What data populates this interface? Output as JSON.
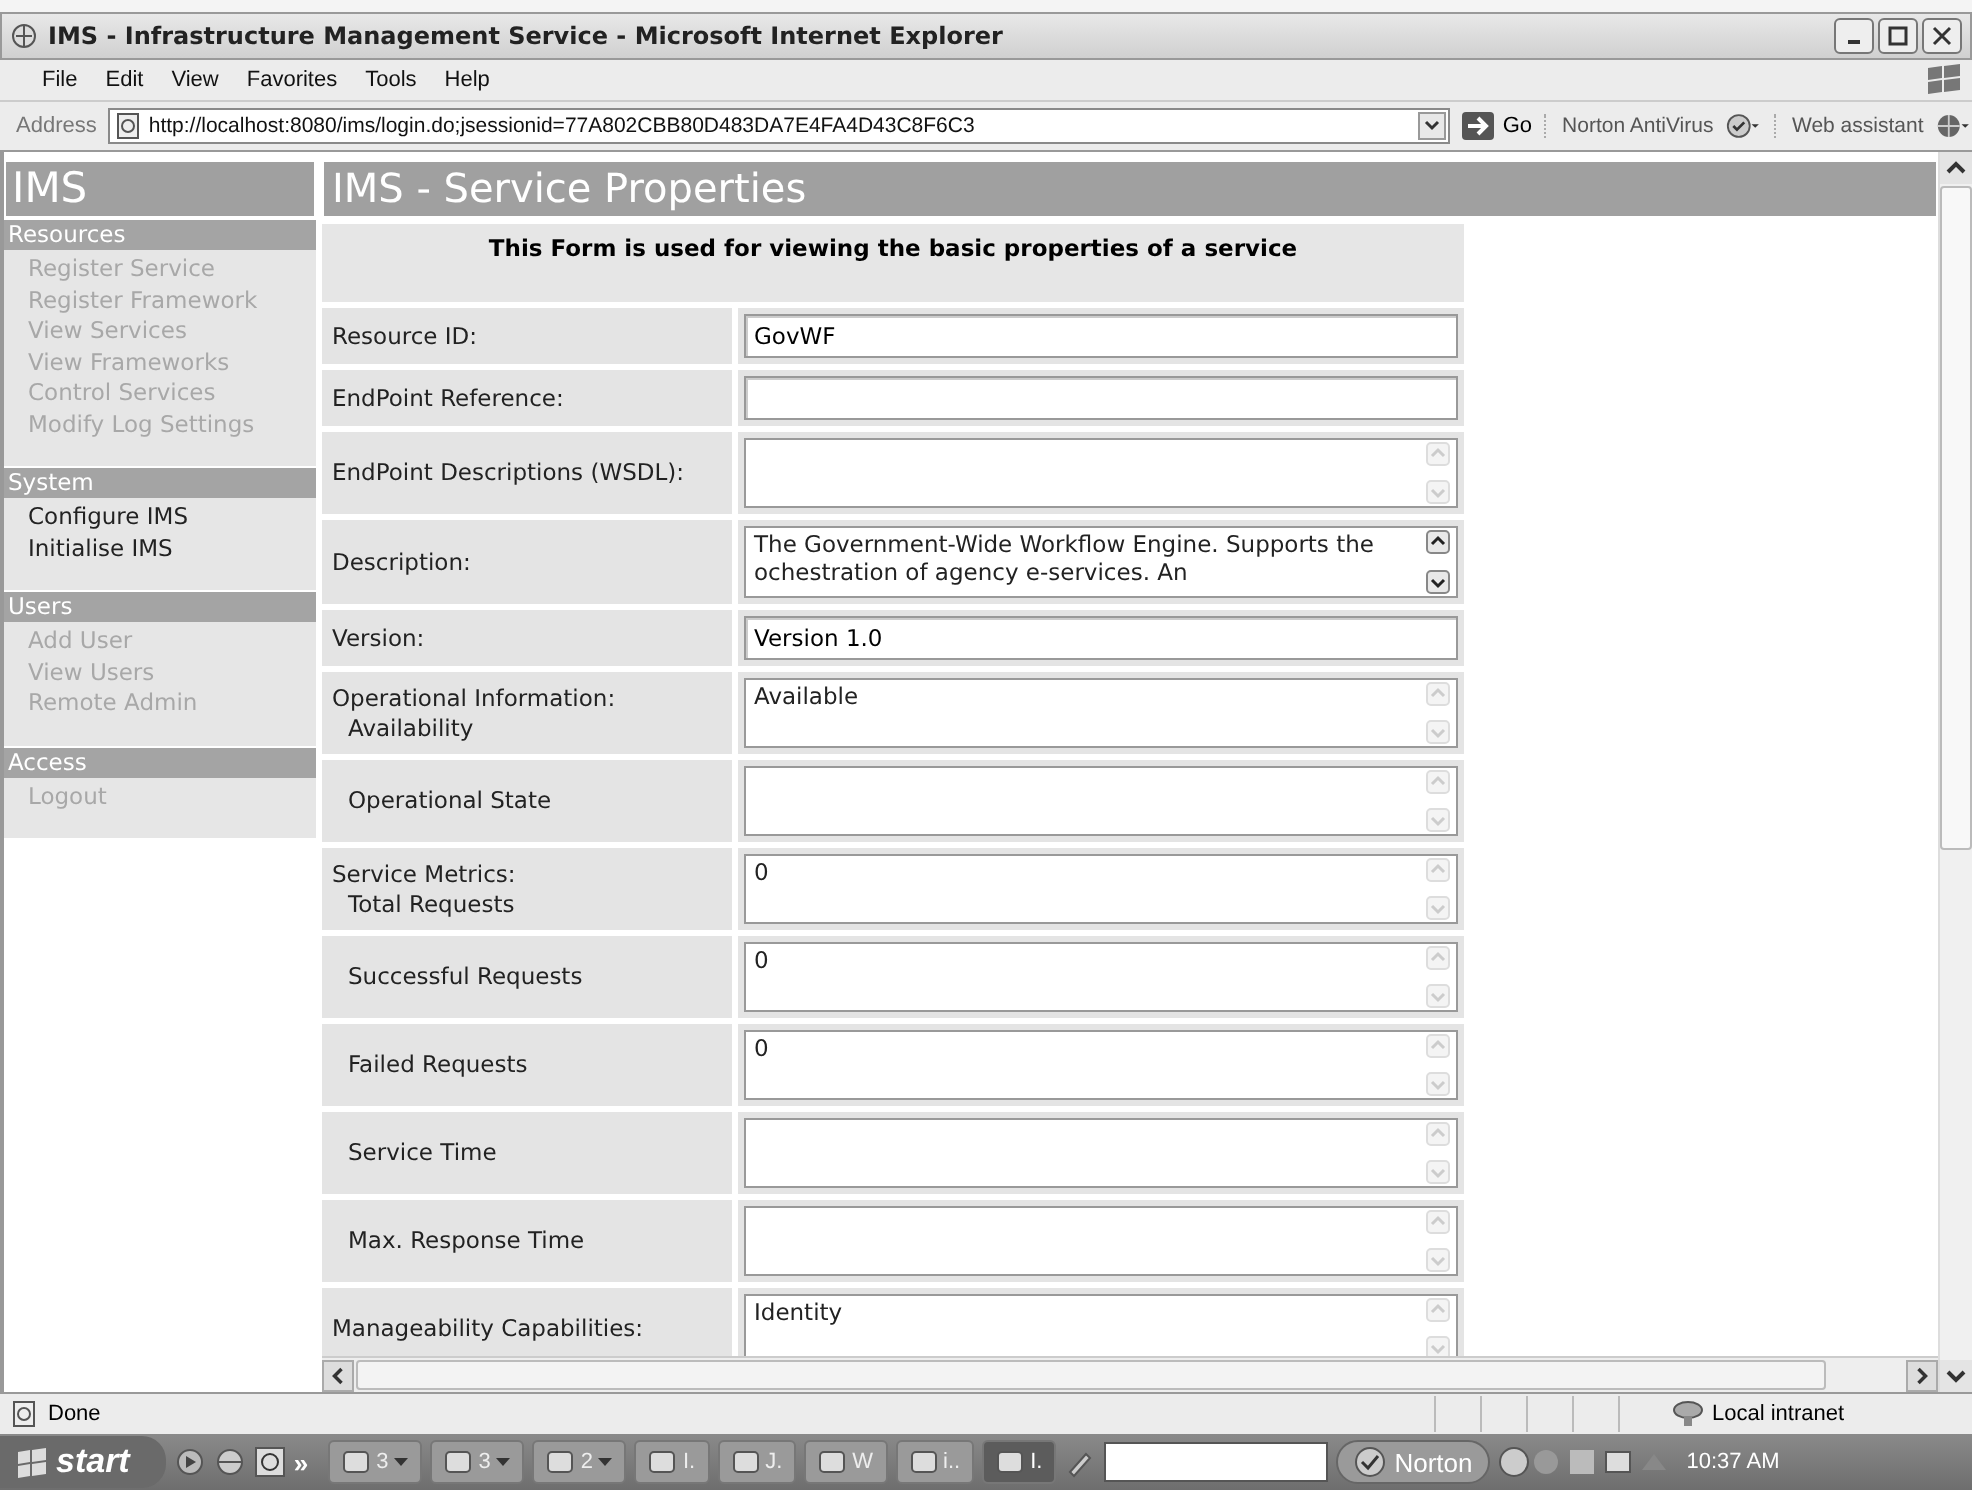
{
  "window": {
    "title": "IMS - Infrastructure Management Service - Microsoft Internet Explorer"
  },
  "menu": [
    "File",
    "Edit",
    "View",
    "Favorites",
    "Tools",
    "Help"
  ],
  "address_bar": {
    "label": "Address",
    "url": "http://localhost:8080/ims/login.do;jsessionid=77A802CBB80D483DA7E4FA4D43C8F6C3",
    "go": "Go",
    "norton": "Norton AntiVirus",
    "assistant": "Web assistant"
  },
  "sidebar": {
    "logo": "IMS",
    "sections": [
      {
        "title": "Resources",
        "items": [
          {
            "label": "Register Service",
            "disabled": true
          },
          {
            "label": "Register Framework",
            "disabled": true
          },
          {
            "label": "View Services",
            "disabled": true
          },
          {
            "label": "View Frameworks",
            "disabled": true
          },
          {
            "label": "Control Services",
            "disabled": true
          },
          {
            "label": "Modify Log Settings",
            "disabled": true
          }
        ]
      },
      {
        "title": "System",
        "items": [
          {
            "label": "Configure IMS",
            "disabled": false
          },
          {
            "label": "Initialise IMS",
            "disabled": false
          }
        ]
      },
      {
        "title": "Users",
        "items": [
          {
            "label": "Add User",
            "disabled": true
          },
          {
            "label": "View Users",
            "disabled": true
          },
          {
            "label": "Remote Admin",
            "disabled": true
          }
        ]
      },
      {
        "title": "Access",
        "items": [
          {
            "label": "Logout",
            "disabled": true
          }
        ]
      }
    ]
  },
  "page": {
    "title": "IMS - Service Properties",
    "intro": "This Form is used for viewing the basic properties of a service",
    "fields": [
      {
        "kind": "text",
        "label": "Resource ID:",
        "value": "GovWF"
      },
      {
        "kind": "text",
        "label": "EndPoint Reference:"
      },
      {
        "kind": "textarea",
        "label": "EndPoint Descriptions (WSDL):",
        "scroll_enabled": false
      },
      {
        "kind": "textarea",
        "label": "Description:",
        "value": "The Government-Wide Workflow Engine. Supports the ochestration of agency e-services. An",
        "scroll_enabled": true
      },
      {
        "kind": "text",
        "label": "Version:",
        "value": "Version 1.0"
      },
      {
        "kind": "textarea",
        "group": "Operational Information:",
        "label": "Availability",
        "value": "Available",
        "scroll_enabled": false
      },
      {
        "kind": "textarea",
        "label": "Operational State",
        "scroll_enabled": false
      },
      {
        "kind": "textarea",
        "group": "Service Metrics:",
        "label": "Total Requests",
        "value": "0",
        "scroll_enabled": false
      },
      {
        "kind": "textarea",
        "label": "Successful Requests",
        "value": "0",
        "scroll_enabled": false
      },
      {
        "kind": "textarea",
        "label": "Failed Requests",
        "value": "0",
        "scroll_enabled": false
      },
      {
        "kind": "textarea",
        "label": "Service Time",
        "scroll_enabled": false
      },
      {
        "kind": "textarea",
        "label": "Max. Response Time",
        "scroll_enabled": false
      },
      {
        "kind": "textarea",
        "group": "Manageability Capabilities:",
        "value": "Identity",
        "scroll_enabled": false
      }
    ]
  },
  "status_bar": {
    "text": "Done",
    "zone": "Local intranet"
  },
  "taskbar": {
    "start": "start",
    "more": "»",
    "buttons": [
      {
        "label": "3",
        "caret": true,
        "selected": false
      },
      {
        "label": "3",
        "caret": true,
        "selected": false
      },
      {
        "label": "2",
        "caret": true,
        "selected": false
      },
      {
        "label": "I.",
        "caret": false,
        "selected": false
      },
      {
        "label": "J.",
        "caret": false,
        "selected": false
      },
      {
        "label": "W",
        "caret": false,
        "selected": false
      },
      {
        "label": "i..",
        "caret": false,
        "selected": false
      },
      {
        "label": "I.",
        "caret": false,
        "selected": true
      }
    ],
    "norton": "Norton",
    "clock": "10:37 AM"
  }
}
